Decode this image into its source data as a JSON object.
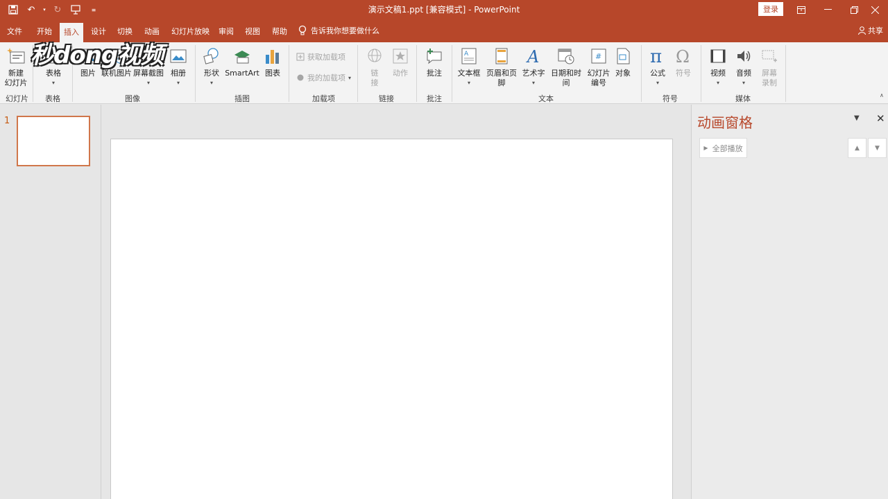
{
  "window": {
    "title": "演示文稿1.ppt [兼容模式] - PowerPoint",
    "login_label": "登录",
    "accent_color": "#b7472a"
  },
  "qat": {
    "save_icon": "save-icon",
    "undo_icon": "undo-icon",
    "redo_icon": "redo-icon",
    "present_icon": "present-from-start-icon",
    "customize_icon": "customize-qat-icon"
  },
  "tabs": {
    "file": "文件",
    "home": "开始",
    "insert": "插入",
    "design": "设计",
    "transitions": "切换",
    "animations": "动画",
    "slideshow": "幻灯片放映",
    "review": "审阅",
    "view": "视图",
    "help": "帮助",
    "tell_me": "告诉我你想要做什么",
    "share": "共享"
  },
  "ribbon": {
    "new_slide": "新建",
    "new_slide_2": "幻灯片",
    "table": "表格",
    "picture": "图片",
    "online_picture": "联机图片",
    "screenshot": "屏幕截图",
    "album": "相册",
    "shapes": "形状",
    "smartart": "SmartArt",
    "chart": "图表",
    "get_addins": "获取加载项",
    "my_addins": "我的加载项",
    "link_1": "链",
    "link_2": "接",
    "action": "动作",
    "comment": "批注",
    "textbox": "文本框",
    "header_footer": "页眉和页脚",
    "wordart": "艺术字",
    "date_time": "日期和时间",
    "slide_number_1": "幻灯片",
    "slide_number_2": "编号",
    "object": "对象",
    "equation": "公式",
    "symbol": "符号",
    "video": "视频",
    "audio": "音频",
    "screen_rec_1": "屏幕",
    "screen_rec_2": "录制",
    "groups": {
      "slides": "幻灯片",
      "tables": "表格",
      "images": "图像",
      "illustrations": "插图",
      "addins": "加载项",
      "links": "链接",
      "comments": "批注",
      "text": "文本",
      "symbols": "符号",
      "media": "媒体"
    }
  },
  "watermark": {
    "text": "秒dong视频"
  },
  "thumbnails": {
    "slide_number": "1"
  },
  "animation_pane": {
    "title": "动画窗格",
    "play_all": "全部播放"
  }
}
